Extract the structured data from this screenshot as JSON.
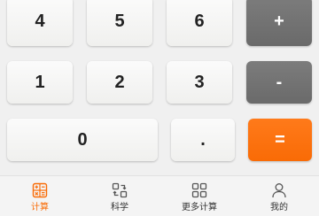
{
  "keypad": {
    "k4": "4",
    "k5": "5",
    "k6": "6",
    "plus": "+",
    "k1": "1",
    "k2": "2",
    "k3": "3",
    "minus": "-",
    "k0": "0",
    "dot": ".",
    "equals": "="
  },
  "tabs": [
    {
      "label": "计算",
      "icon": "calculator-icon",
      "active": true
    },
    {
      "label": "科学",
      "icon": "scientific-convert-icon",
      "active": false
    },
    {
      "label": "更多计算",
      "icon": "grid-apps-icon",
      "active": false
    },
    {
      "label": "我的",
      "icon": "profile-icon",
      "active": false
    }
  ],
  "colors": {
    "accent": "#f96b06",
    "operator": "#737373",
    "background": "#f0f0f0",
    "key": "#f7f7f5",
    "icon_inactive": "#555555"
  }
}
